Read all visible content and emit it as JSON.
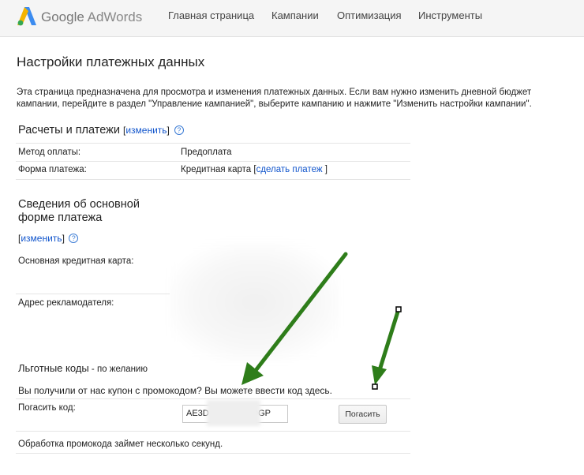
{
  "header": {
    "logo_google": "Google",
    "logo_product": "AdWords",
    "nav": [
      "Главная страница",
      "Кампании",
      "Оптимизация",
      "Инструменты"
    ]
  },
  "page": {
    "title": "Настройки платежных данных",
    "intro": "Эта страница предназначена для просмотра и изменения платежных данных. Если вам нужно изменить дневной бюджет кампании, перейдите в раздел \"Управление кампанией\", выберите кампанию и нажмите \"Изменить настройки кампании\"."
  },
  "billing": {
    "title": "Расчеты и платежи",
    "open_bracket": "[",
    "edit_link": "изменить",
    "close_bracket": "]",
    "help": "?",
    "rows": [
      {
        "label": "Метод оплаты:",
        "value": "Предоплата"
      },
      {
        "label": "Форма платежа:",
        "value": "Кредитная карта"
      }
    ],
    "pay_link": "сделать платеж"
  },
  "primary": {
    "title_line1": "Сведения об основной",
    "title_line2": "форме платежа",
    "edit_link": "изменить",
    "help": "?",
    "card_label": "Основная кредитная карта:",
    "address_label": "Адрес рекламодателя:"
  },
  "promo": {
    "title": "Льготные коды",
    "title_suffix": " - по желанию",
    "question": "Вы получили от нас купон с промокодом? Вы можете ввести код здесь.",
    "redeem_label": "Погасить код:",
    "code_value": "AE3D              -HDGP",
    "button": "Погасить",
    "processing": "Обработка промокода займет несколько секунд."
  },
  "colors": {
    "link": "#1155cc",
    "arrow": "#2e7d1a"
  }
}
